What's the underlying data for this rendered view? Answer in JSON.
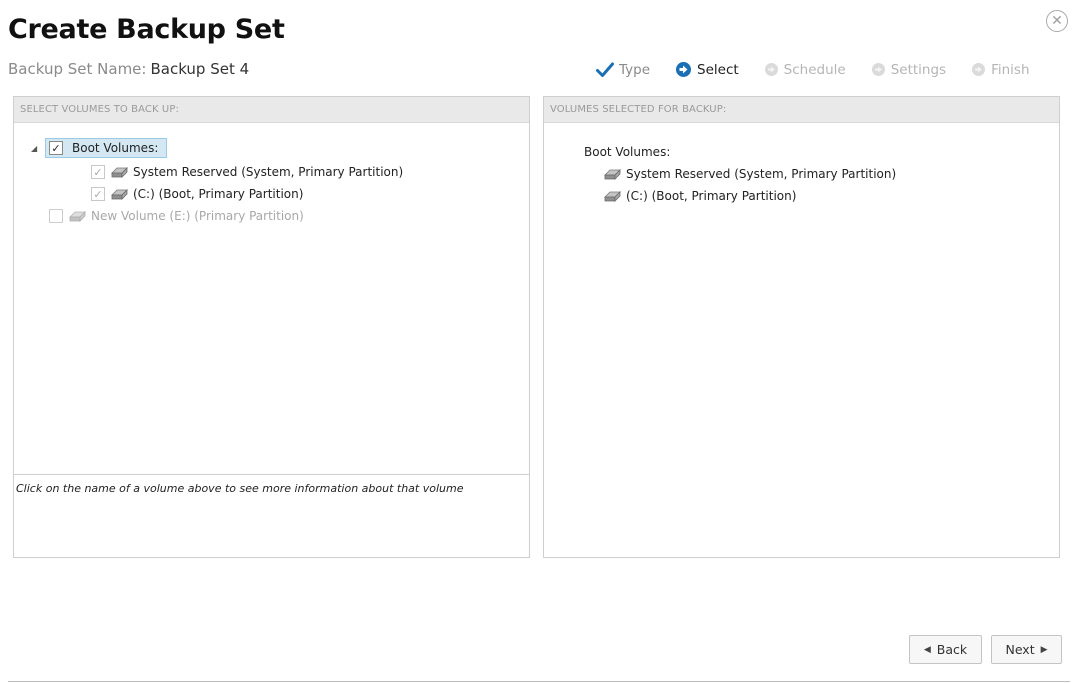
{
  "dialog": {
    "title": "Create Backup Set",
    "set_name_label": "Backup Set Name:",
    "set_name_value": "Backup Set 4",
    "close_icon": "close-icon"
  },
  "wizard_steps": [
    {
      "label": "Type",
      "state": "done",
      "icon": "checkmark-icon"
    },
    {
      "label": "Select",
      "state": "active",
      "icon": "arrow-circle-icon"
    },
    {
      "label": "Schedule",
      "state": "pending",
      "icon": "circle-icon"
    },
    {
      "label": "Settings",
      "state": "pending",
      "icon": "circle-icon"
    },
    {
      "label": "Finish",
      "state": "pending",
      "icon": "circle-icon"
    }
  ],
  "left_panel": {
    "header": "SELECT VOLUMES TO BACK UP:",
    "tree": {
      "root_label": "Boot Volumes:",
      "root_checked": true,
      "children": [
        {
          "label": "System Reserved (System, Primary Partition)",
          "checked": true
        },
        {
          "label": "(C:) (Boot, Primary Partition)",
          "checked": true
        }
      ],
      "other": {
        "label": "New Volume (E:) (Primary Partition)",
        "checked": false
      }
    },
    "info_text": "Click on the name of a volume above to see more information about that volume"
  },
  "right_panel": {
    "header": "VOLUMES SELECTED FOR BACKUP:",
    "group_label": "Boot Volumes:",
    "items": [
      "System Reserved (System, Primary Partition)",
      "(C:) (Boot, Primary Partition)"
    ]
  },
  "buttons": {
    "back": "Back",
    "next": "Next"
  },
  "colors": {
    "accent": "#1a6fb5",
    "selection_bg": "#d4e8f4",
    "pending": "#b5b5b5"
  }
}
